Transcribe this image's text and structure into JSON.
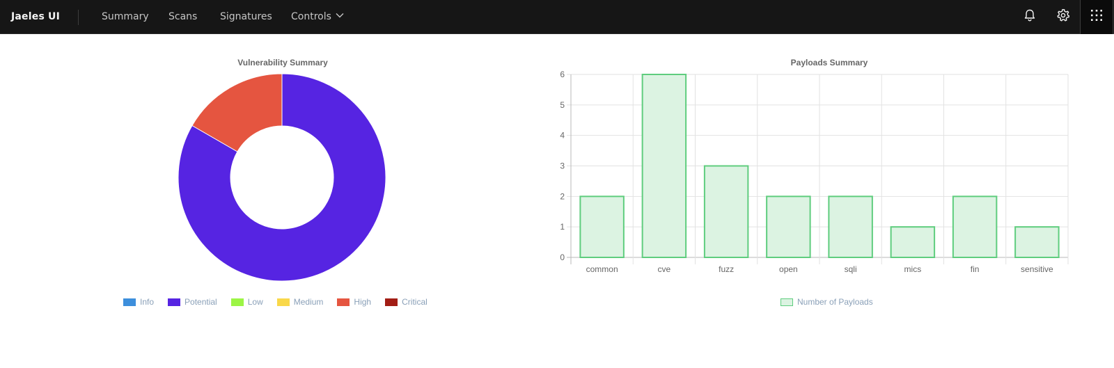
{
  "header": {
    "brand": "Jaeles UI",
    "nav": [
      {
        "label": "Summary"
      },
      {
        "label": "Scans"
      },
      {
        "label": "Signatures"
      },
      {
        "label": "Controls"
      }
    ],
    "icons": [
      "bell-icon",
      "gear-icon",
      "app-switcher-icon"
    ]
  },
  "colors": {
    "topbar": "#161616",
    "info": "#3d8fdc",
    "potential": "#5624e2",
    "low": "#9cf545",
    "medium": "#f9d84a",
    "high": "#e55540",
    "critical": "#a21d15",
    "bar_fill": "#dcf3e2",
    "bar_border": "#5fcd7e"
  },
  "vuln_chart": {
    "title": "Vulnerability Summary",
    "legend": [
      {
        "label": "Info",
        "color": "#3d8fdc"
      },
      {
        "label": "Potential",
        "color": "#5624e2"
      },
      {
        "label": "Low",
        "color": "#9cf545"
      },
      {
        "label": "Medium",
        "color": "#f9d84a"
      },
      {
        "label": "High",
        "color": "#e55540"
      },
      {
        "label": "Critical",
        "color": "#a21d15"
      }
    ]
  },
  "payload_chart": {
    "title": "Payloads Summary",
    "legend_label": "Number of Payloads"
  },
  "chart_data": [
    {
      "type": "pie",
      "title": "Vulnerability Summary",
      "labels": [
        "Info",
        "Potential",
        "Low",
        "Medium",
        "High",
        "Critical"
      ],
      "values": [
        0,
        5,
        0,
        0,
        1,
        0
      ],
      "colors": [
        "#3d8fdc",
        "#5624e2",
        "#9cf545",
        "#f9d84a",
        "#e55540",
        "#a21d15"
      ],
      "legend": "bottom"
    },
    {
      "type": "bar",
      "title": "Payloads Summary",
      "categories": [
        "common",
        "cve",
        "fuzz",
        "open",
        "sqli",
        "mics",
        "fin",
        "sensitive"
      ],
      "series": [
        {
          "name": "Number of Payloads",
          "values": [
            2,
            6,
            3,
            2,
            2,
            1,
            2,
            1
          ]
        }
      ],
      "ylim": [
        0,
        6
      ],
      "yticks": [
        0,
        1,
        2,
        3,
        4,
        5,
        6
      ],
      "grid": true,
      "legend": "bottom"
    }
  ]
}
